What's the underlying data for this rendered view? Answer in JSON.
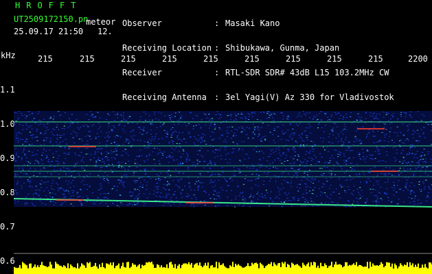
{
  "header": {
    "logo": "HROFFT",
    "filename": "UT2509172150.pn",
    "filename_suffix": "meteor",
    "datetime": "25.09.17 21:50",
    "frac": "12."
  },
  "info": {
    "rows": [
      {
        "label": "Observer",
        "value": "Masaki Kano"
      },
      {
        "label": "Receiving Location",
        "value": "Shibukawa, Gunma, Japan"
      },
      {
        "label": "Receiver",
        "value": "RTL-SDR SDR# 43dB L15 103.2MHz CW"
      },
      {
        "label": "Receiving Antenna",
        "value": "3el Yagi(V) Az 330 for Vladivostok"
      }
    ],
    "colon": ":"
  },
  "axes": {
    "y_unit": "kHz",
    "x_ticks": [
      "215",
      "215",
      "215",
      "215",
      "215",
      "215",
      "215",
      "215",
      "215",
      "2200"
    ],
    "y_ticks": [
      "1.1",
      "1.0",
      "0.9",
      "0.8",
      "0.7",
      "0.6"
    ]
  },
  "colors": {
    "text_green": "#33ff33",
    "text_white": "#ffffff",
    "waterfall_noise": "#1a3fd6",
    "echo_line": "#40ff90",
    "strong_echo": "#ff4030",
    "spectrum_bar": "#ffff00"
  }
}
